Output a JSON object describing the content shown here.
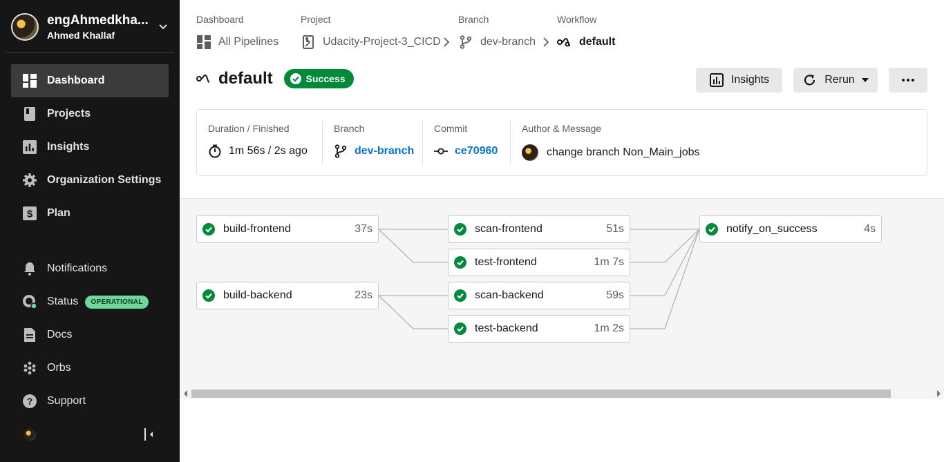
{
  "user": {
    "name": "engAhmedkha...",
    "full_name": "Ahmed Khallaf"
  },
  "nav": {
    "dashboard": "Dashboard",
    "projects": "Projects",
    "insights": "Insights",
    "org_settings": "Organization Settings",
    "plan": "Plan",
    "notifications": "Notifications",
    "status": "Status",
    "status_badge": "OPERATIONAL",
    "docs": "Docs",
    "orbs": "Orbs",
    "support": "Support"
  },
  "breadcrumb": {
    "dashboard_label": "Dashboard",
    "dashboard_value": "All Pipelines",
    "project_label": "Project",
    "project_value": "Udacity-Project-3_CICD",
    "branch_label": "Branch",
    "branch_value": "dev-branch",
    "workflow_label": "Workflow",
    "workflow_value": "default"
  },
  "header": {
    "title": "default",
    "status": "Success",
    "insights_button": "Insights",
    "rerun_button": "Rerun"
  },
  "info": {
    "duration_label": "Duration / Finished",
    "duration_value": "1m 56s / 2s ago",
    "branch_label": "Branch",
    "branch_value": "dev-branch",
    "commit_label": "Commit",
    "commit_value": "ce70960",
    "author_label": "Author & Message",
    "message": "change branch Non_Main_jobs"
  },
  "jobs": [
    {
      "name": "build-frontend",
      "duration": "37s",
      "status": "success"
    },
    {
      "name": "build-backend",
      "duration": "23s",
      "status": "success"
    },
    {
      "name": "scan-frontend",
      "duration": "51s",
      "status": "success"
    },
    {
      "name": "test-frontend",
      "duration": "1m 7s",
      "status": "success"
    },
    {
      "name": "scan-backend",
      "duration": "59s",
      "status": "success"
    },
    {
      "name": "test-backend",
      "duration": "1m 2s",
      "status": "success"
    },
    {
      "name": "notify_on_success",
      "duration": "4s",
      "status": "success"
    }
  ],
  "colors": {
    "sidebar_bg": "#161616",
    "success": "#008a3a",
    "link": "#0475ce",
    "operational": "#6dd89a"
  }
}
